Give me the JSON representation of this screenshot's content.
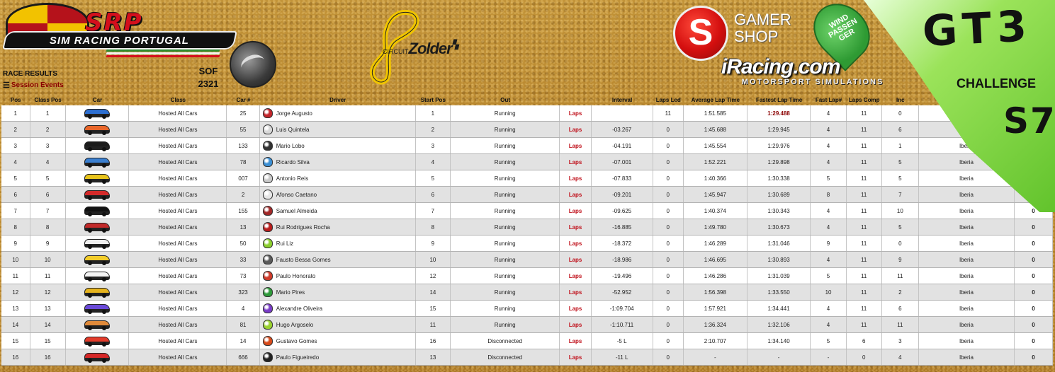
{
  "header": {
    "srp_logo_text": "SRP",
    "srp_banner_text": "SIM RACING PORTUGAL",
    "race_results": "RACE RESULTS",
    "session_events": "Session Events",
    "sof_label": "SOF",
    "sof_value": "2321",
    "circuit_prefix": "CIRCUIT",
    "circuit_name": "Zolder",
    "sponsor1_line1": "GAMER",
    "sponsor1_line2": "SHOP",
    "sponsor2": "WIND PASSEN GER",
    "iracing": "iRacing.com",
    "iracing_sub": "MOTORSPORT SIMULATIONS",
    "series": "GT3",
    "series_sub": "CHALLENGE",
    "season": "S7"
  },
  "colors": {
    "accent_red": "#c0121c",
    "srp_red": "#d40f1c",
    "green": "#62c32c",
    "gold": "#b8862f"
  },
  "columns": [
    "Pos",
    "Class Pos",
    "Car",
    "Class",
    "Car #",
    "Driver",
    "Start Pos",
    "Out",
    "",
    "Interval",
    "Laps Led",
    "Average Lap Time",
    "Fastest Lap Time",
    "Fast Lap#",
    "Laps Comp",
    "Inc",
    "",
    ""
  ],
  "rows": [
    {
      "pos": "1",
      "cpos": "1",
      "car_color": "#2d6fd1",
      "class": "Hosted All Cars",
      "num": "25",
      "driver": "Jorge Augusto",
      "helmet": "#c4252b",
      "spos": "1",
      "out": "Running",
      "laps": "Laps",
      "interval": "",
      "led": "11",
      "avg": "1:51.585",
      "fast": "1:29.488",
      "flap": "4",
      "comp": "11",
      "inc": "0",
      "club": "",
      "tot": ""
    },
    {
      "pos": "2",
      "cpos": "2",
      "car_color": "#e8662a",
      "class": "Hosted All Cars",
      "num": "55",
      "driver": "Luis Quintela",
      "helmet": "#d8d8d8",
      "spos": "2",
      "out": "Running",
      "laps": "Laps",
      "interval": "-03.267",
      "led": "0",
      "avg": "1:45.688",
      "fast": "1:29.945",
      "flap": "4",
      "comp": "11",
      "inc": "6",
      "club": "Ib",
      "tot": ""
    },
    {
      "pos": "3",
      "cpos": "3",
      "car_color": "#1c1c1c",
      "class": "Hosted All Cars",
      "num": "133",
      "driver": "Mario Lobo",
      "helmet": "#333333",
      "spos": "3",
      "out": "Running",
      "laps": "Laps",
      "interval": "-04.191",
      "led": "0",
      "avg": "1:45.554",
      "fast": "1:29.976",
      "flap": "4",
      "comp": "11",
      "inc": "1",
      "club": "Iberia",
      "tot": ""
    },
    {
      "pos": "4",
      "cpos": "4",
      "car_color": "#3a7fd0",
      "class": "Hosted All Cars",
      "num": "78",
      "driver": "Ricardo Silva",
      "helmet": "#3b8fd4",
      "spos": "4",
      "out": "Running",
      "laps": "Laps",
      "interval": "-07.001",
      "led": "0",
      "avg": "1:52.221",
      "fast": "1:29.898",
      "flap": "4",
      "comp": "11",
      "inc": "5",
      "club": "Iberia",
      "tot": ""
    },
    {
      "pos": "5",
      "cpos": "5",
      "car_color": "#e8c41c",
      "class": "Hosted All Cars",
      "num": "007",
      "driver": "Antonio Reis",
      "helmet": "#c9c9c9",
      "spos": "5",
      "out": "Running",
      "laps": "Laps",
      "interval": "-07.833",
      "led": "0",
      "avg": "1:40.366",
      "fast": "1:30.338",
      "flap": "5",
      "comp": "11",
      "inc": "5",
      "club": "Iberia",
      "tot": ""
    },
    {
      "pos": "6",
      "cpos": "6",
      "car_color": "#d42a2a",
      "class": "Hosted All Cars",
      "num": "2",
      "driver": "Afonso Caetano",
      "helmet": "#e6e6e6",
      "spos": "6",
      "out": "Running",
      "laps": "Laps",
      "interval": "-09.201",
      "led": "0",
      "avg": "1:45.947",
      "fast": "1:30.689",
      "flap": "8",
      "comp": "11",
      "inc": "7",
      "club": "Iberia",
      "tot": ""
    },
    {
      "pos": "7",
      "cpos": "7",
      "car_color": "#111111",
      "class": "Hosted All Cars",
      "num": "155",
      "driver": "Samuel Almeida",
      "helmet": "#a22828",
      "spos": "7",
      "out": "Running",
      "laps": "Laps",
      "interval": "-09.625",
      "led": "0",
      "avg": "1:40.374",
      "fast": "1:30.343",
      "flap": "4",
      "comp": "11",
      "inc": "10",
      "club": "Iberia",
      "tot": "0"
    },
    {
      "pos": "8",
      "cpos": "8",
      "car_color": "#c22a2a",
      "class": "Hosted All Cars",
      "num": "13",
      "driver": "Rui Rodrigues Rocha",
      "helmet": "#b81c1c",
      "spos": "8",
      "out": "Running",
      "laps": "Laps",
      "interval": "-16.885",
      "led": "0",
      "avg": "1:49.780",
      "fast": "1:30.673",
      "flap": "4",
      "comp": "11",
      "inc": "5",
      "club": "Iberia",
      "tot": "0"
    },
    {
      "pos": "9",
      "cpos": "9",
      "car_color": "#f0f0f0",
      "class": "Hosted All Cars",
      "num": "50",
      "driver": "Rui Liz",
      "helmet": "#8ccf2e",
      "spos": "9",
      "out": "Running",
      "laps": "Laps",
      "interval": "-18.372",
      "led": "0",
      "avg": "1:46.289",
      "fast": "1:31.046",
      "flap": "9",
      "comp": "11",
      "inc": "0",
      "club": "Iberia",
      "tot": "0"
    },
    {
      "pos": "10",
      "cpos": "10",
      "car_color": "#f2cc2a",
      "class": "Hosted All Cars",
      "num": "33",
      "driver": "Fausto Bessa Gomes",
      "helmet": "#5a5a5a",
      "spos": "10",
      "out": "Running",
      "laps": "Laps",
      "interval": "-18.986",
      "led": "0",
      "avg": "1:46.695",
      "fast": "1:30.893",
      "flap": "4",
      "comp": "11",
      "inc": "9",
      "club": "Iberia",
      "tot": "0"
    },
    {
      "pos": "11",
      "cpos": "11",
      "car_color": "#f4f4f4",
      "class": "Hosted All Cars",
      "num": "73",
      "driver": "Paulo Honorato",
      "helmet": "#d03a2a",
      "spos": "12",
      "out": "Running",
      "laps": "Laps",
      "interval": "-19.496",
      "led": "0",
      "avg": "1:46.286",
      "fast": "1:31.039",
      "flap": "5",
      "comp": "11",
      "inc": "11",
      "club": "Iberia",
      "tot": "0"
    },
    {
      "pos": "12",
      "cpos": "12",
      "car_color": "#e6b41e",
      "class": "Hosted All Cars",
      "num": "323",
      "driver": "Mario Pires",
      "helmet": "#2e9a3a",
      "spos": "14",
      "out": "Running",
      "laps": "Laps",
      "interval": "-52.952",
      "led": "0",
      "avg": "1:56.398",
      "fast": "1:33.550",
      "flap": "10",
      "comp": "11",
      "inc": "2",
      "club": "Iberia",
      "tot": "0"
    },
    {
      "pos": "13",
      "cpos": "13",
      "car_color": "#6a4ad8",
      "class": "Hosted All Cars",
      "num": "4",
      "driver": "Alexandre Oliveira",
      "helmet": "#7a3cc8",
      "spos": "15",
      "out": "Running",
      "laps": "Laps",
      "interval": "-1:09.704",
      "led": "0",
      "avg": "1:57.921",
      "fast": "1:34.441",
      "flap": "4",
      "comp": "11",
      "inc": "6",
      "club": "Iberia",
      "tot": "0"
    },
    {
      "pos": "14",
      "cpos": "14",
      "car_color": "#e08a3a",
      "class": "Hosted All Cars",
      "num": "81",
      "driver": "Hugo Argoselo",
      "helmet": "#9ad12e",
      "spos": "11",
      "out": "Running",
      "laps": "Laps",
      "interval": "-1:10.711",
      "led": "0",
      "avg": "1:36.324",
      "fast": "1:32.106",
      "flap": "4",
      "comp": "11",
      "inc": "11",
      "club": "Iberia",
      "tot": "0"
    },
    {
      "pos": "15",
      "cpos": "15",
      "car_color": "#e33b2a",
      "class": "Hosted All Cars",
      "num": "14",
      "driver": "Gustavo Gomes",
      "helmet": "#d84a1a",
      "spos": "16",
      "out": "Disconnected",
      "laps": "Laps",
      "interval": "-5 L",
      "led": "0",
      "avg": "2:10.707",
      "fast": "1:34.140",
      "flap": "5",
      "comp": "6",
      "inc": "3",
      "club": "Iberia",
      "tot": "0"
    },
    {
      "pos": "16",
      "cpos": "16",
      "car_color": "#d62828",
      "class": "Hosted All Cars",
      "num": "666",
      "driver": "Paulo Figueiredo",
      "helmet": "#222222",
      "spos": "13",
      "out": "Disconnected",
      "laps": "Laps",
      "interval": "-11 L",
      "led": "0",
      "avg": "-",
      "fast": "-",
      "flap": "-",
      "comp": "0",
      "inc": "4",
      "club": "Iberia",
      "tot": "0"
    }
  ]
}
